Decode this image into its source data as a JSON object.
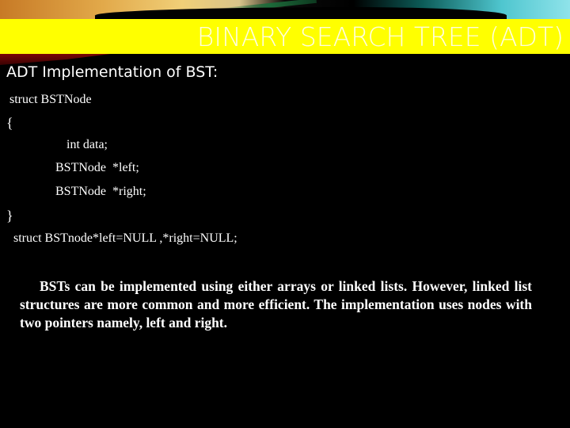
{
  "slide": {
    "title": "BINARY SEARCH TREE (ADT)",
    "subtitle": "ADT Implementation of BST:",
    "code_lines": [
      "struct BSTNode",
      "{",
      "int data;",
      "BSTNode  *left;",
      "BSTNode  *right;",
      "}",
      "struct BSTnode*left=NULL ,*right=NULL;"
    ],
    "paragraph": "BSTs can be implemented using either arrays or linked lists. However, linked list structures are more common and more efficient. The implementation uses nodes with two pointers namely, left and right.",
    "colors": {
      "title_bar": "#ffff00",
      "background": "#000000",
      "text": "#ffffff"
    }
  }
}
